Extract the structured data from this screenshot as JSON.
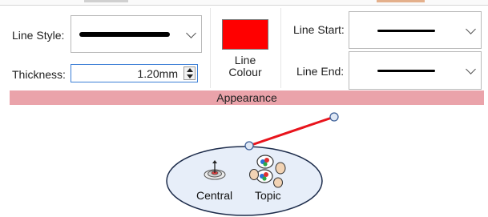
{
  "appearance_group": {
    "line_style_label": "Line Style:",
    "thickness_label": "Thickness:",
    "thickness_value": "1.20mm",
    "line_colour_label_1": "Line",
    "line_colour_label_2": "Colour",
    "line_colour_value": "#ff0000",
    "line_start_label": "Line Start:",
    "line_end_label": "Line End:",
    "group_title": "Appearance"
  },
  "diagram": {
    "node_text_1": "Central",
    "node_text_2": "Topic",
    "connector_color": "#e8141c",
    "node_fill": "#e7eef9",
    "node_border": "#1c2b4a"
  },
  "colors": {
    "group_bar": "#eaa3aa",
    "focus_border": "#3c7fd6"
  }
}
